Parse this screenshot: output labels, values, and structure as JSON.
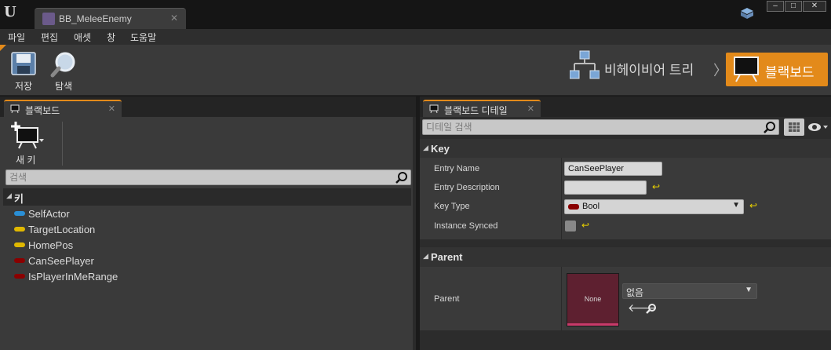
{
  "window": {
    "tab_title": "BB_MeleeEnemy",
    "controls": {
      "minimize": "‒",
      "maximize": "□",
      "close": "✕"
    }
  },
  "menu": {
    "items": [
      "파일",
      "편집",
      "애셋",
      "창",
      "도움말"
    ]
  },
  "toolbar": {
    "save_label": "저장",
    "browse_label": "탐색",
    "behavior_tree_label": "비헤이비어 트리",
    "blackboard_label": "블랙보드"
  },
  "blackboard_panel": {
    "tab_label": "블랙보드",
    "new_key_label": "새 키",
    "search_placeholder": "검색",
    "category_label": "키",
    "keys": [
      {
        "name": "SelfActor",
        "color": "#2a8fd6"
      },
      {
        "name": "TargetLocation",
        "color": "#e0b800"
      },
      {
        "name": "HomePos",
        "color": "#e0b800"
      },
      {
        "name": "CanSeePlayer",
        "color": "#8a0000"
      },
      {
        "name": "IsPlayerInMeRange",
        "color": "#8a0000"
      }
    ]
  },
  "details_panel": {
    "tab_label": "블랙보드 디테일",
    "search_placeholder": "디테일 검색",
    "key_section": {
      "title": "Key",
      "entry_name_label": "Entry Name",
      "entry_name_value": "CanSeePlayer",
      "entry_description_label": "Entry Description",
      "entry_description_value": "",
      "key_type_label": "Key Type",
      "key_type_value": "Bool",
      "instance_synced_label": "Instance Synced",
      "instance_synced_checked": false
    },
    "parent_section": {
      "title": "Parent",
      "parent_label": "Parent",
      "thumbnail_text": "None",
      "dropdown_value": "없음"
    }
  },
  "colors": {
    "accent": "#e38a1a",
    "reset_arrow": "#e8d000",
    "bool_pin": "#8a0000"
  }
}
